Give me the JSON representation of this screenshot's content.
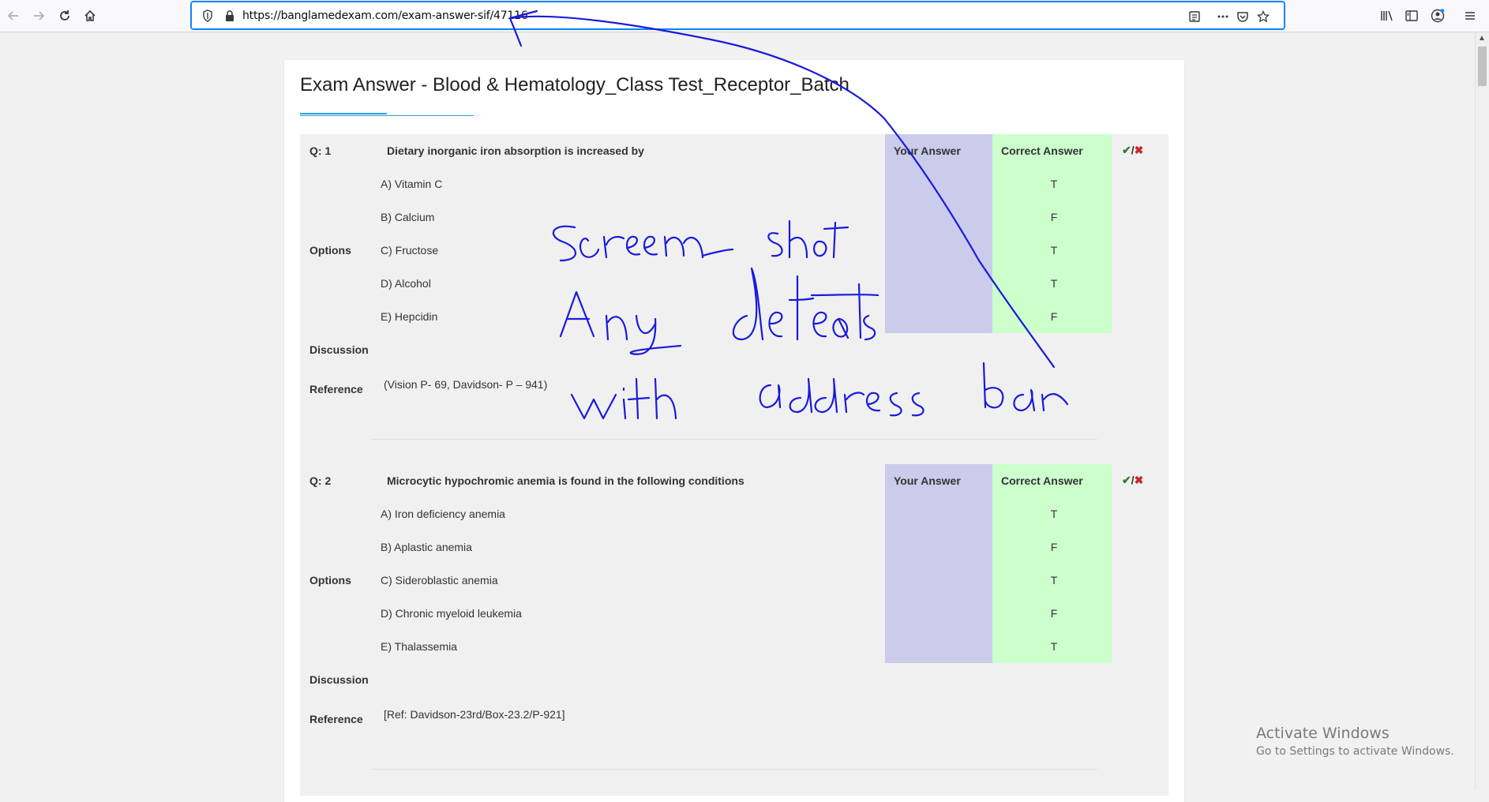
{
  "browser": {
    "url": "https://banglamedexam.com/exam-answer-sif/47116"
  },
  "page": {
    "title": "Exam Answer - Blood & Hematology_Class Test_Receptor_Batch"
  },
  "labels": {
    "options": "Options",
    "discussion": "Discussion",
    "reference": "Reference",
    "your_answer": "Your Answer",
    "correct_answer": "Correct Answer",
    "tick": "✔",
    "slash": "/",
    "cross": "✖"
  },
  "questions": [
    {
      "number": "Q: 1",
      "text": "Dietary inorganic iron absorption is increased by",
      "options": [
        "A) Vitamin C",
        "B)  Calcium",
        "C)  Fructose",
        "D)  Alcohol",
        "E)  Hepcidin"
      ],
      "correct": [
        "T",
        "F",
        "T",
        "T",
        "F"
      ],
      "reference": "(Vision P- 69, Davidson- P – 941)"
    },
    {
      "number": "Q: 2",
      "text": "Microcytic hypochromic anemia is found in the following conditions",
      "options": [
        "A)  Iron deficiency anemia",
        "B)  Aplastic anemia",
        "C) Sideroblastic anemia",
        "D)  Chronic myeloid leukemia",
        "E)  Thalassemia"
      ],
      "correct": [
        "T",
        "F",
        "T",
        "F",
        "T"
      ],
      "reference": "[Ref: Davidson-23rd/Box-23.2/P-921]"
    }
  ],
  "watermark": {
    "line1": "Activate Windows",
    "line2": "Go to Settings to activate Windows."
  },
  "colors": {
    "your_answer_bg": "#cbcbeb",
    "correct_answer_bg": "#ccffcc",
    "annotation_ink": "#1a1adb",
    "url_focus": "#0a84ff"
  },
  "icons": [
    "back-icon",
    "forward-icon",
    "reload-icon",
    "home-icon",
    "shield-icon",
    "lock-icon",
    "reader-view-icon",
    "more-icon",
    "pocket-icon",
    "bookmark-star-icon",
    "library-icon",
    "sidebar-icon",
    "account-icon",
    "menu-icon"
  ]
}
